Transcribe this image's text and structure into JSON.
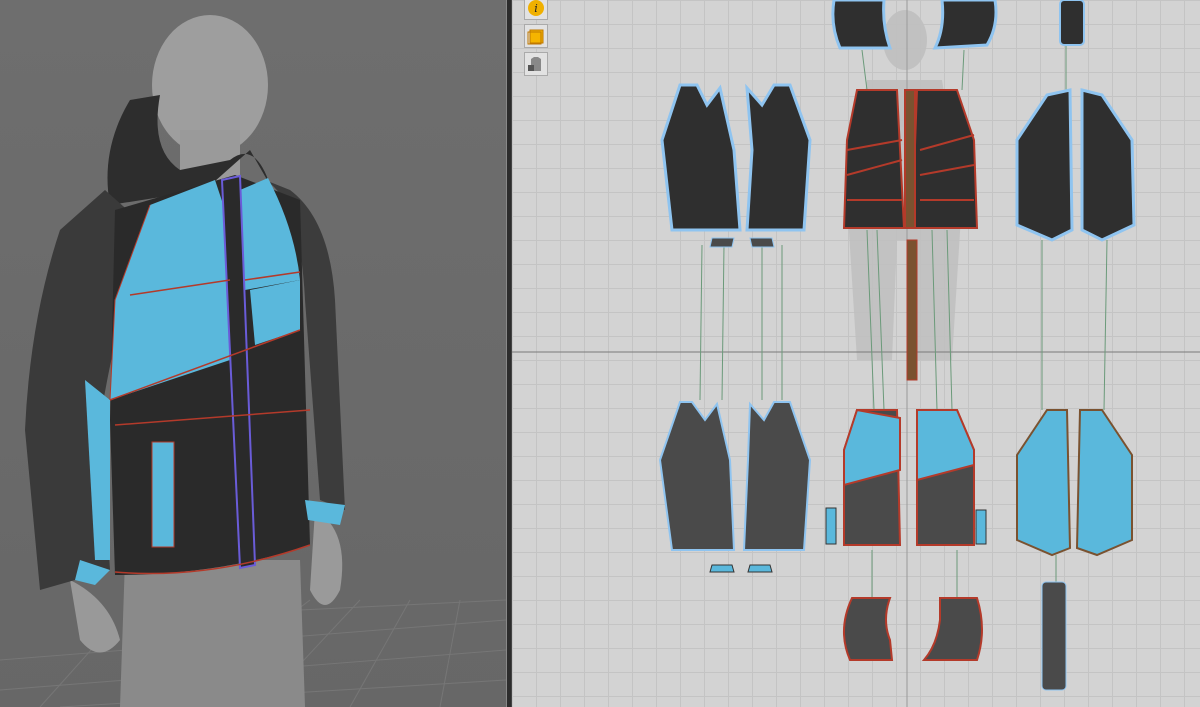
{
  "app": {
    "views": [
      "3d-avatar-window",
      "2d-pattern-window"
    ]
  },
  "toolbar": {
    "icons": [
      "info-icon",
      "texture-icon",
      "garment-lock-icon"
    ]
  },
  "colors": {
    "accent_blue": "#5ab8dc",
    "fabric_dark": "#2f2f2f",
    "fabric_gray": "#4a4a4a",
    "seam_red": "#b43a2a",
    "selection_blue": "#8fc4f0",
    "grid_line": "#c4c4c4",
    "canvas_bg": "#d3d3d3"
  }
}
